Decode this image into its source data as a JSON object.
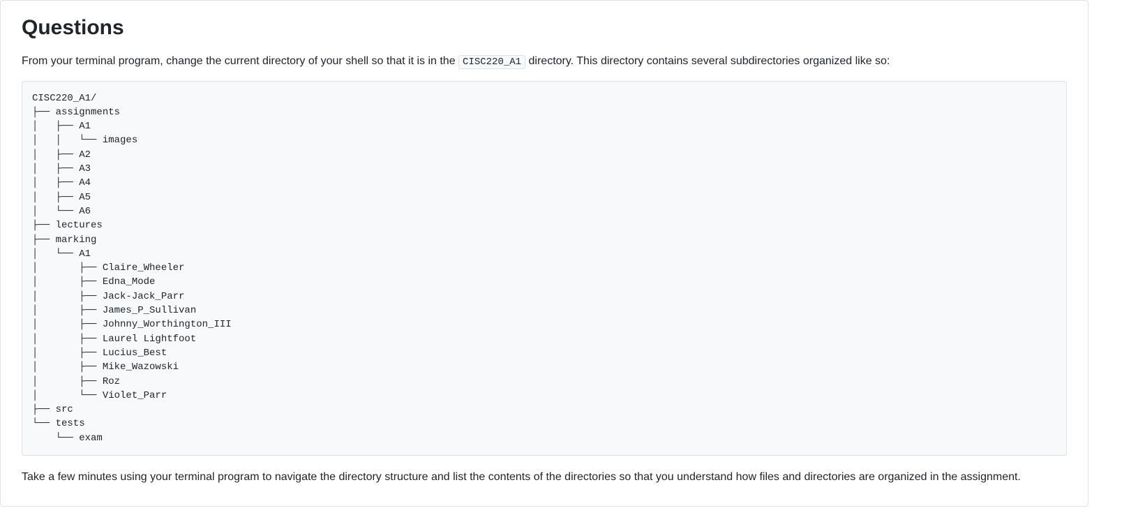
{
  "heading": "Questions",
  "intro": {
    "before_code": "From your terminal program, change the current directory of your shell so that it is in the ",
    "code": "CISC220_A1",
    "after_code": " directory. This directory contains several subdirectories organized like so:"
  },
  "tree": "CISC220_A1/\n├── assignments\n│   ├── A1\n│   │   └── images\n│   ├── A2\n│   ├── A3\n│   ├── A4\n│   ├── A5\n│   └── A6\n├── lectures\n├── marking\n│   └── A1\n│       ├── Claire_Wheeler\n│       ├── Edna_Mode\n│       ├── Jack-Jack_Parr\n│       ├── James_P_Sullivan\n│       ├── Johnny_Worthington_III\n│       ├── Laurel Lightfoot\n│       ├── Lucius_Best\n│       ├── Mike_Wazowski\n│       ├── Roz\n│       └── Violet_Parr\n├── src\n└── tests\n    └── exam",
  "outro": "Take a few minutes using your terminal program to navigate the directory structure and list the contents of the directories so that you understand how files and directories are organized in the assignment."
}
